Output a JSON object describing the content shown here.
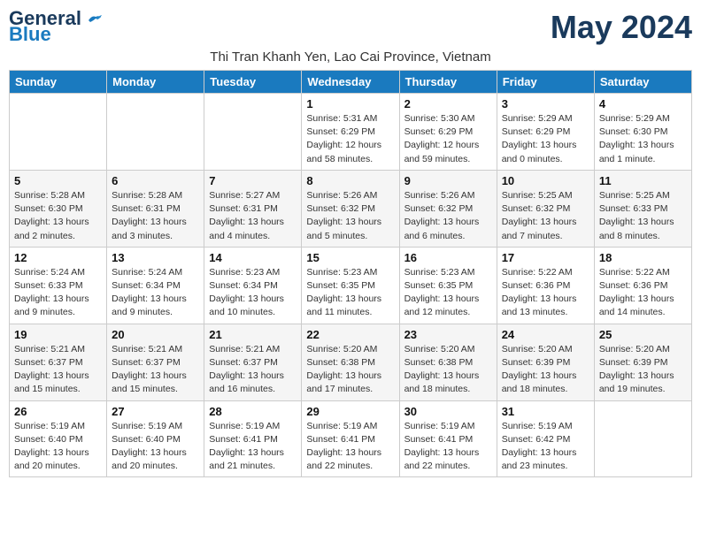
{
  "header": {
    "logo_line1": "General",
    "logo_line2": "Blue",
    "month_title": "May 2024",
    "subtitle": "Thi Tran Khanh Yen, Lao Cai Province, Vietnam"
  },
  "days_of_week": [
    "Sunday",
    "Monday",
    "Tuesday",
    "Wednesday",
    "Thursday",
    "Friday",
    "Saturday"
  ],
  "weeks": [
    [
      {
        "day": "",
        "info": ""
      },
      {
        "day": "",
        "info": ""
      },
      {
        "day": "",
        "info": ""
      },
      {
        "day": "1",
        "info": "Sunrise: 5:31 AM\nSunset: 6:29 PM\nDaylight: 12 hours\nand 58 minutes."
      },
      {
        "day": "2",
        "info": "Sunrise: 5:30 AM\nSunset: 6:29 PM\nDaylight: 12 hours\nand 59 minutes."
      },
      {
        "day": "3",
        "info": "Sunrise: 5:29 AM\nSunset: 6:29 PM\nDaylight: 13 hours\nand 0 minutes."
      },
      {
        "day": "4",
        "info": "Sunrise: 5:29 AM\nSunset: 6:30 PM\nDaylight: 13 hours\nand 1 minute."
      }
    ],
    [
      {
        "day": "5",
        "info": "Sunrise: 5:28 AM\nSunset: 6:30 PM\nDaylight: 13 hours\nand 2 minutes."
      },
      {
        "day": "6",
        "info": "Sunrise: 5:28 AM\nSunset: 6:31 PM\nDaylight: 13 hours\nand 3 minutes."
      },
      {
        "day": "7",
        "info": "Sunrise: 5:27 AM\nSunset: 6:31 PM\nDaylight: 13 hours\nand 4 minutes."
      },
      {
        "day": "8",
        "info": "Sunrise: 5:26 AM\nSunset: 6:32 PM\nDaylight: 13 hours\nand 5 minutes."
      },
      {
        "day": "9",
        "info": "Sunrise: 5:26 AM\nSunset: 6:32 PM\nDaylight: 13 hours\nand 6 minutes."
      },
      {
        "day": "10",
        "info": "Sunrise: 5:25 AM\nSunset: 6:32 PM\nDaylight: 13 hours\nand 7 minutes."
      },
      {
        "day": "11",
        "info": "Sunrise: 5:25 AM\nSunset: 6:33 PM\nDaylight: 13 hours\nand 8 minutes."
      }
    ],
    [
      {
        "day": "12",
        "info": "Sunrise: 5:24 AM\nSunset: 6:33 PM\nDaylight: 13 hours\nand 9 minutes."
      },
      {
        "day": "13",
        "info": "Sunrise: 5:24 AM\nSunset: 6:34 PM\nDaylight: 13 hours\nand 9 minutes."
      },
      {
        "day": "14",
        "info": "Sunrise: 5:23 AM\nSunset: 6:34 PM\nDaylight: 13 hours\nand 10 minutes."
      },
      {
        "day": "15",
        "info": "Sunrise: 5:23 AM\nSunset: 6:35 PM\nDaylight: 13 hours\nand 11 minutes."
      },
      {
        "day": "16",
        "info": "Sunrise: 5:23 AM\nSunset: 6:35 PM\nDaylight: 13 hours\nand 12 minutes."
      },
      {
        "day": "17",
        "info": "Sunrise: 5:22 AM\nSunset: 6:36 PM\nDaylight: 13 hours\nand 13 minutes."
      },
      {
        "day": "18",
        "info": "Sunrise: 5:22 AM\nSunset: 6:36 PM\nDaylight: 13 hours\nand 14 minutes."
      }
    ],
    [
      {
        "day": "19",
        "info": "Sunrise: 5:21 AM\nSunset: 6:37 PM\nDaylight: 13 hours\nand 15 minutes."
      },
      {
        "day": "20",
        "info": "Sunrise: 5:21 AM\nSunset: 6:37 PM\nDaylight: 13 hours\nand 15 minutes."
      },
      {
        "day": "21",
        "info": "Sunrise: 5:21 AM\nSunset: 6:37 PM\nDaylight: 13 hours\nand 16 minutes."
      },
      {
        "day": "22",
        "info": "Sunrise: 5:20 AM\nSunset: 6:38 PM\nDaylight: 13 hours\nand 17 minutes."
      },
      {
        "day": "23",
        "info": "Sunrise: 5:20 AM\nSunset: 6:38 PM\nDaylight: 13 hours\nand 18 minutes."
      },
      {
        "day": "24",
        "info": "Sunrise: 5:20 AM\nSunset: 6:39 PM\nDaylight: 13 hours\nand 18 minutes."
      },
      {
        "day": "25",
        "info": "Sunrise: 5:20 AM\nSunset: 6:39 PM\nDaylight: 13 hours\nand 19 minutes."
      }
    ],
    [
      {
        "day": "26",
        "info": "Sunrise: 5:19 AM\nSunset: 6:40 PM\nDaylight: 13 hours\nand 20 minutes."
      },
      {
        "day": "27",
        "info": "Sunrise: 5:19 AM\nSunset: 6:40 PM\nDaylight: 13 hours\nand 20 minutes."
      },
      {
        "day": "28",
        "info": "Sunrise: 5:19 AM\nSunset: 6:41 PM\nDaylight: 13 hours\nand 21 minutes."
      },
      {
        "day": "29",
        "info": "Sunrise: 5:19 AM\nSunset: 6:41 PM\nDaylight: 13 hours\nand 22 minutes."
      },
      {
        "day": "30",
        "info": "Sunrise: 5:19 AM\nSunset: 6:41 PM\nDaylight: 13 hours\nand 22 minutes."
      },
      {
        "day": "31",
        "info": "Sunrise: 5:19 AM\nSunset: 6:42 PM\nDaylight: 13 hours\nand 23 minutes."
      },
      {
        "day": "",
        "info": ""
      }
    ]
  ]
}
